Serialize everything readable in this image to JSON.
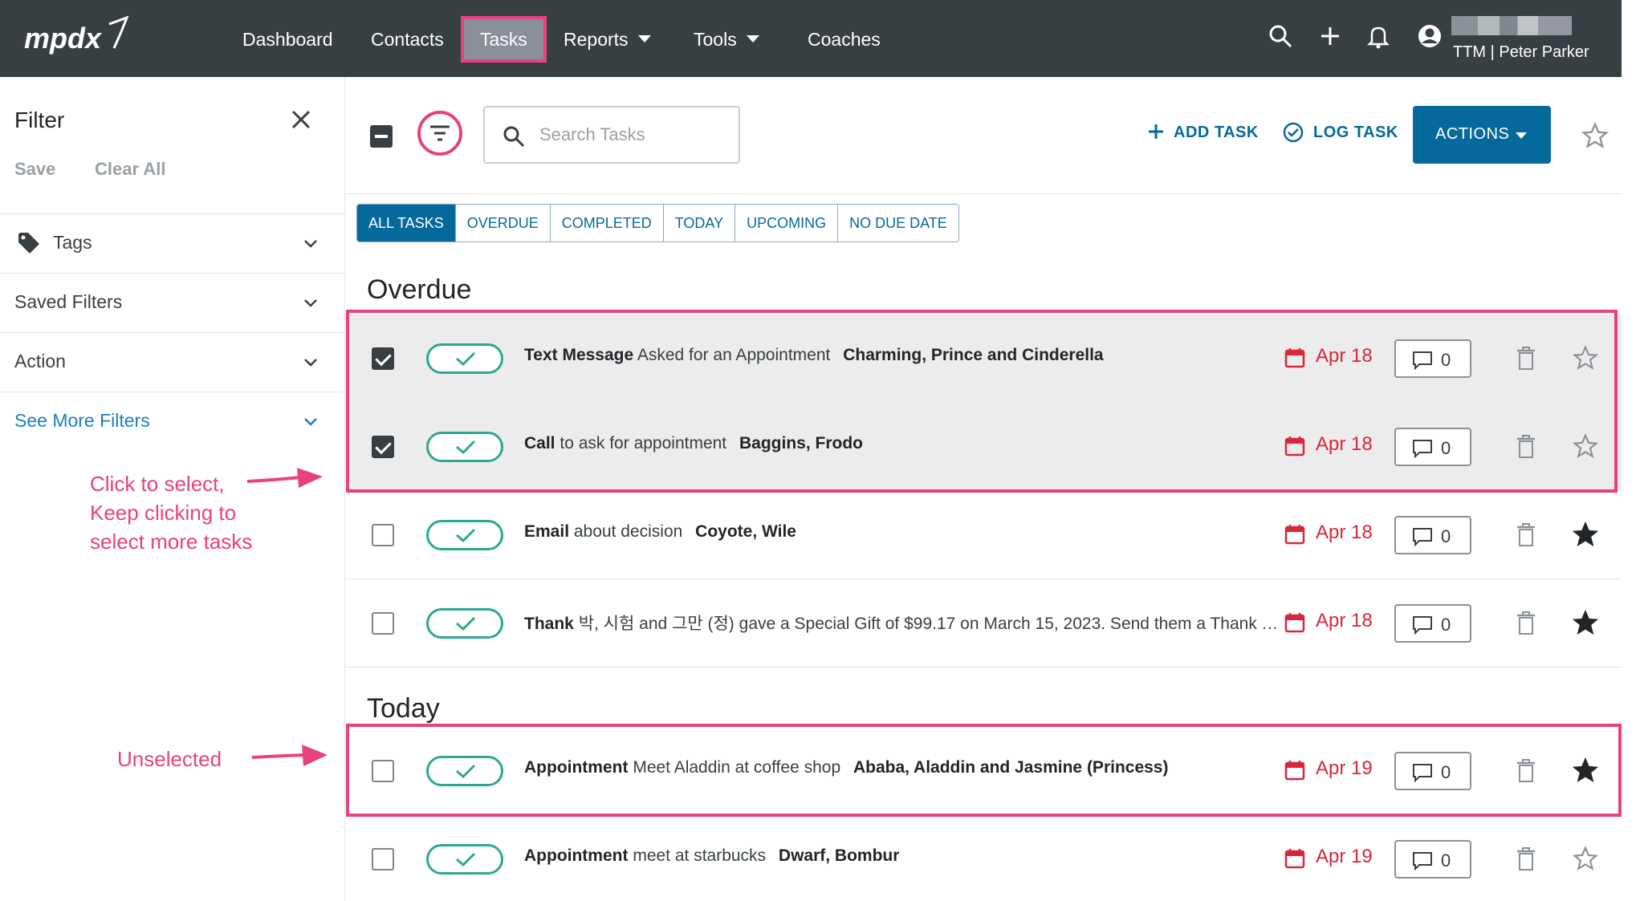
{
  "nav": {
    "logo_text": "mpdx",
    "links": [
      "Dashboard",
      "Contacts",
      "Tasks",
      "Reports",
      "Tools",
      "Coaches"
    ],
    "user_label": "TTM | Peter Parker"
  },
  "sidebar": {
    "title": "Filter",
    "save_label": "Save",
    "clear_label": "Clear All",
    "items": [
      "Tags",
      "Saved Filters",
      "Action",
      "See More Filters"
    ]
  },
  "annotations": {
    "select_tip": "Click to select,\nKeep clicking to\nselect more tasks",
    "unselected_tip": "Unselected"
  },
  "toolbar": {
    "search_placeholder": "Search Tasks",
    "add_task": "ADD TASK",
    "log_task": "LOG TASK",
    "actions": "ACTIONS"
  },
  "tabs": [
    "ALL TASKS",
    "OVERDUE",
    "COMPLETED",
    "TODAY",
    "UPCOMING",
    "NO DUE DATE"
  ],
  "sections": {
    "overdue": "Overdue",
    "today": "Today"
  },
  "tasks": [
    {
      "type": "Text Message",
      "subject": "Asked for an Appointment",
      "contact": "Charming, Prince and Cinderella",
      "due": "Apr 18",
      "comments": "0",
      "selected": true,
      "starred": false
    },
    {
      "type": "Call",
      "subject": "to ask for appointment",
      "contact": "Baggins, Frodo",
      "due": "Apr 18",
      "comments": "0",
      "selected": true,
      "starred": false
    },
    {
      "type": "Email",
      "subject": "about decision",
      "contact": "Coyote, Wile",
      "due": "Apr 18",
      "comments": "0",
      "selected": false,
      "starred": true
    },
    {
      "type": "Thank",
      "subject": "박, 시험 and 그만 (정) gave a Special Gift of $99.17 on March 15, 2023. Send them a Thank You.",
      "contact": "박...",
      "due": "Apr 18",
      "comments": "0",
      "selected": false,
      "starred": true
    },
    {
      "type": "Appointment",
      "subject": "Meet Aladdin at coffee shop",
      "contact": "Ababa, Aladdin and Jasmine (Princess)",
      "due": "Apr 19",
      "comments": "0",
      "selected": false,
      "starred": true
    },
    {
      "type": "Appointment",
      "subject": "meet at starbucks",
      "contact": "Dwarf, Bombur",
      "due": "Apr 19",
      "comments": "0",
      "selected": false,
      "starred": false
    }
  ],
  "colors": {
    "nav_bg": "#383f43",
    "primary": "#05699b",
    "highlight": "#e8417d",
    "due": "#d9263b",
    "complete": "#2ba88f"
  }
}
